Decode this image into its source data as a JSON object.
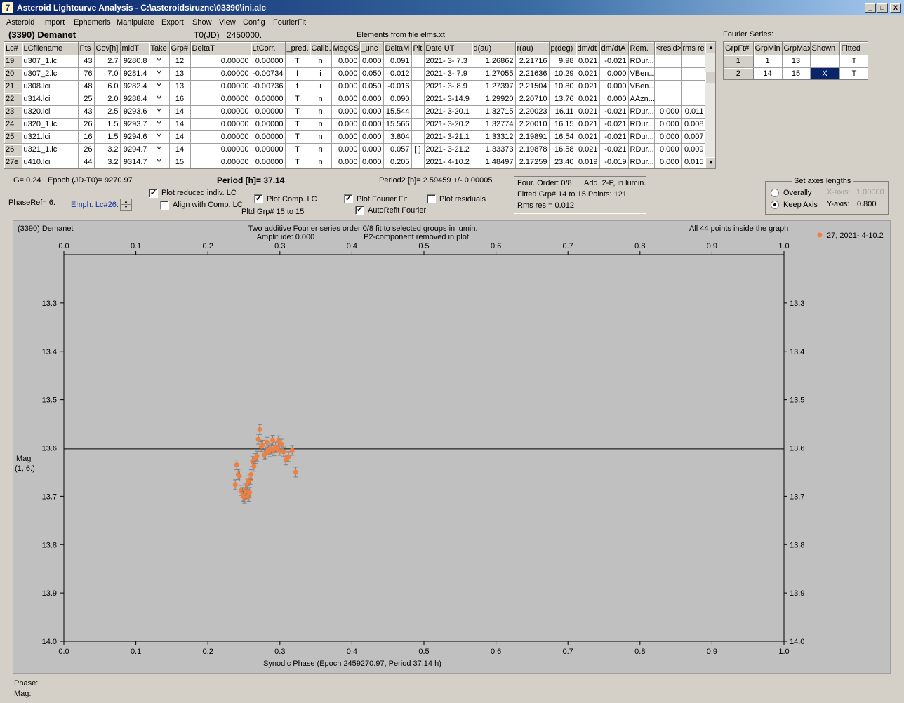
{
  "window": {
    "title": "Asteroid Lightcurve Analysis - C:\\asteroids\\ruzne\\03390\\ini.alc",
    "app_icon": "7",
    "controls": {
      "minimize": "_",
      "maximize": "□",
      "close": "X"
    }
  },
  "menu": [
    "Asteroid",
    "Import",
    "Ephemeris",
    "Manipulate",
    "Export",
    "Show",
    "View",
    "Config",
    "FourierFit"
  ],
  "header": {
    "asteroid": "(3390) Demanet",
    "t0": "T0(JD)= 2450000.",
    "elements": "Elements from file elms.xt",
    "fourier_series_label": "Fourier Series:"
  },
  "lc_table": {
    "columns": [
      "Lc#",
      "LCfilename",
      "Pts",
      "Cov[h]",
      "midT",
      "Take",
      "Grp#",
      "DeltaT",
      "LtCorr.",
      "_pred.",
      "Calib.",
      "MagCS",
      "_unc",
      "DeltaM",
      "Plt",
      "Date UT",
      "d(au)",
      "r(au)",
      "p(deg)",
      "dm/dt",
      "dm/dtA",
      "Rem.",
      "<resid>",
      "rms res"
    ],
    "rows": [
      [
        "19",
        "u307_1.lci",
        "43",
        "2.7",
        "9280.8",
        "Y",
        "12",
        "0.00000",
        "0.00000",
        "T",
        "n",
        "0.000",
        "0.000",
        "0.091",
        "",
        "2021- 3- 7.3",
        "1.26862",
        "2.21716",
        "9.98",
        "0.021",
        "-0.021",
        "RDur...",
        "",
        ""
      ],
      [
        "20",
        "u307_2.lci",
        "76",
        "7.0",
        "9281.4",
        "Y",
        "13",
        "0.00000",
        "-0.00734",
        "f",
        "i",
        "0.000",
        "0.050",
        "0.012",
        "",
        "2021- 3- 7.9",
        "1.27055",
        "2.21636",
        "10.29",
        "0.021",
        "0.000",
        "VBen...",
        "",
        ""
      ],
      [
        "21",
        "u308.lci",
        "48",
        "6.0",
        "9282.4",
        "Y",
        "13",
        "0.00000",
        "-0.00736",
        "f",
        "i",
        "0.000",
        "0.050",
        "-0.016",
        "",
        "2021- 3- 8.9",
        "1.27397",
        "2.21504",
        "10.80",
        "0.021",
        "0.000",
        "VBen...",
        "",
        ""
      ],
      [
        "22",
        "u314.lci",
        "25",
        "2.0",
        "9288.4",
        "Y",
        "16",
        "0.00000",
        "0.00000",
        "T",
        "n",
        "0.000",
        "0.000",
        "0.090",
        "",
        "2021- 3-14.9",
        "1.29920",
        "2.20710",
        "13.76",
        "0.021",
        "0.000",
        "AAzn...",
        "",
        ""
      ],
      [
        "23",
        "u320.lci",
        "43",
        "2.5",
        "9293.6",
        "Y",
        "14",
        "0.00000",
        "0.00000",
        "T",
        "n",
        "0.000",
        "0.000",
        "15.544",
        "",
        "2021- 3-20.1",
        "1.32715",
        "2.20023",
        "16.11",
        "0.021",
        "-0.021",
        "RDur...",
        "0.000",
        "0.011"
      ],
      [
        "24",
        "u320_1.lci",
        "26",
        "1.5",
        "9293.7",
        "Y",
        "14",
        "0.00000",
        "0.00000",
        "T",
        "n",
        "0.000",
        "0.000",
        "15.566",
        "",
        "2021- 3-20.2",
        "1.32774",
        "2.20010",
        "16.15",
        "0.021",
        "-0.021",
        "RDur...",
        "0.000",
        "0.008"
      ],
      [
        "25",
        "u321.lci",
        "16",
        "1.5",
        "9294.6",
        "Y",
        "14",
        "0.00000",
        "0.00000",
        "T",
        "n",
        "0.000",
        "0.000",
        "3.804",
        "",
        "2021- 3-21.1",
        "1.33312",
        "2.19891",
        "16.54",
        "0.021",
        "-0.021",
        "RDur...",
        "0.000",
        "0.007"
      ],
      [
        "26",
        "u321_1.lci",
        "26",
        "3.2",
        "9294.7",
        "Y",
        "14",
        "0.00000",
        "0.00000",
        "T",
        "n",
        "0.000",
        "0.000",
        "0.057",
        "[ ]",
        "2021- 3-21.2",
        "1.33373",
        "2.19878",
        "16.58",
        "0.021",
        "-0.021",
        "RDur...",
        "0.000",
        "0.009"
      ],
      [
        "27e",
        "u410.lci",
        "44",
        "3.2",
        "9314.7",
        "Y",
        "15",
        "0.00000",
        "0.00000",
        "T",
        "n",
        "0.000",
        "0.000",
        "0.205",
        "",
        "2021- 4-10.2",
        "1.48497",
        "2.17259",
        "23.40",
        "0.019",
        "-0.019",
        "RDur...",
        "0.000",
        "0.015"
      ]
    ]
  },
  "fourier_table": {
    "columns": [
      "GrpFt#",
      "GrpMin",
      "GrpMax",
      "Shown",
      "Fitted"
    ],
    "rows": [
      [
        "1",
        "1",
        "13",
        "",
        "T"
      ],
      [
        "2",
        "14",
        "15",
        "X",
        "T"
      ]
    ]
  },
  "info": {
    "g": "G= 0.24",
    "epoch": "Epoch (JD-T0)= 9270.97",
    "period": "Period [h]= 37.14",
    "period2": "Period2 [h]= 2.59459 +/- 0.00005",
    "phaseref": "PhaseRef= 6.",
    "emph": "Emph. Lc#26:",
    "pltd_grp": "Pltd Grp#  15 to  15"
  },
  "checkboxes": [
    {
      "label": "Plot reduced indiv. LC",
      "checked": true
    },
    {
      "label": "Align with Comp. LC",
      "checked": false
    },
    {
      "label": "Plot Comp. LC",
      "checked": true
    },
    {
      "label": "Plot Fourier Fit",
      "checked": true
    },
    {
      "label": "AutoRefit Fourier",
      "checked": true
    },
    {
      "label": "Plot residuals",
      "checked": false
    }
  ],
  "fit_info": {
    "line1a": "Four. Order:  0/8",
    "line1b": "Add. 2-P, in lumin.",
    "line2": "Fitted Grp# 14 to 15 Points: 121",
    "line3": "Rms res      = 0.012"
  },
  "axes_box": {
    "title": "Set axes lengths",
    "overally": "Overally",
    "keep_axis": "Keep Axis",
    "x_label": "X-axis:",
    "x_value": "1.00000",
    "y_label": "Y-axis:",
    "y_value": "0.800",
    "selected": "keep_axis"
  },
  "plot": {
    "top_left": "(3390) Demanet",
    "title1": "Two additive Fourier series order 0/8 fit to selected groups in lumin.",
    "title2a": "Amplitude: 0.000",
    "title2b": "P2-component removed in plot",
    "top_right": "All 44 points inside the graph",
    "legend": "27; 2021- 4-10.2",
    "y_label_1": "Mag",
    "y_label_2": "(1, 6.)",
    "x_label": "Synodic Phase (Epoch 2459270.97, Period 37.14 h)"
  },
  "chart_data": {
    "type": "scatter",
    "xlim": [
      0.0,
      1.0
    ],
    "ylim": [
      14.0,
      13.2
    ],
    "x_ticks": [
      0.0,
      0.1,
      0.2,
      0.3,
      0.4,
      0.5,
      0.6,
      0.7,
      0.8,
      0.9,
      1.0
    ],
    "x_tick_labels": [
      "0.0",
      "0.1",
      "0.2",
      "0.3",
      "0.4",
      "0.5",
      "0.6",
      "0.7",
      "0.8",
      "0.9",
      "1.0"
    ],
    "y_ticks": [
      13.3,
      13.4,
      13.5,
      13.6,
      13.7,
      13.8,
      13.9,
      14.0
    ],
    "y_tick_labels": [
      "13.3",
      "13.4",
      "13.5",
      "13.6",
      "13.7",
      "13.8",
      "13.9",
      "14.0"
    ],
    "fit_line_y": 13.602,
    "color": "#f08040",
    "legend_position": "top-right",
    "series": [
      {
        "name": "27; 2021- 4-10.2",
        "x": [
          0.238,
          0.24,
          0.242,
          0.244,
          0.246,
          0.248,
          0.249,
          0.25,
          0.251,
          0.252,
          0.253,
          0.254,
          0.255,
          0.256,
          0.257,
          0.258,
          0.259,
          0.26,
          0.262,
          0.264,
          0.266,
          0.268,
          0.27,
          0.272,
          0.274,
          0.276,
          0.278,
          0.28,
          0.282,
          0.284,
          0.286,
          0.288,
          0.29,
          0.292,
          0.294,
          0.296,
          0.298,
          0.3,
          0.302,
          0.305,
          0.308,
          0.312,
          0.317,
          0.322
        ],
        "y": [
          13.676,
          13.635,
          13.655,
          13.658,
          13.688,
          13.692,
          13.7,
          13.698,
          13.704,
          13.685,
          13.695,
          13.688,
          13.675,
          13.668,
          13.7,
          13.692,
          13.665,
          13.655,
          13.628,
          13.638,
          13.622,
          13.617,
          13.582,
          13.562,
          13.597,
          13.594,
          13.614,
          13.612,
          13.588,
          13.604,
          13.608,
          13.602,
          13.584,
          13.606,
          13.598,
          13.6,
          13.585,
          13.605,
          13.592,
          13.608,
          13.625,
          13.618,
          13.605,
          13.65
        ]
      }
    ]
  }
}
